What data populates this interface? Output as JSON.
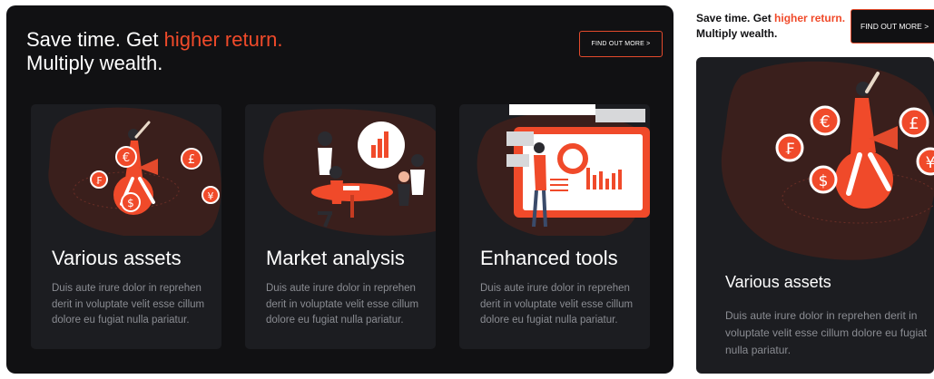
{
  "hero": {
    "title_part1": "Save time. Get ",
    "title_accent": "higher return.",
    "title_line2": "Multiply wealth.",
    "cta_label": "FIND OUT MORE >"
  },
  "cards": [
    {
      "title": "Various assets",
      "body": "Duis aute irure dolor in reprehen derit in voluptate velit esse cillum dolore eu fugiat nulla pariatur.",
      "illustration": "currency-person-illustration"
    },
    {
      "title": "Market analysis",
      "body": "Duis aute irure dolor in reprehen derit in voluptate velit esse cillum dolore eu fugiat nulla pariatur.",
      "illustration": "meeting-illustration"
    },
    {
      "title": "Enhanced tools",
      "body": "Duis aute irure dolor in reprehen derit in voluptate velit esse cillum dolore eu fugiat nulla pariatur.",
      "illustration": "dashboard-illustration"
    }
  ],
  "side_preview": {
    "title_part1": "Save time. Get ",
    "title_accent": "higher return.",
    "title_line2": "Multiply wealth.",
    "cta_label": "FIND OUT MORE >",
    "card_title": "Various assets",
    "card_body": "Duis aute irure dolor in reprehen derit in voluptate velit esse cillum dolore eu fugiat nulla pariatur."
  },
  "currency_symbols": [
    "€",
    "£",
    "₣",
    "$",
    "¥"
  ],
  "colors": {
    "accent": "#f04a2a",
    "panel_bg": "#111113",
    "card_bg": "#1c1d21",
    "blob": "#3a1f1c",
    "body_text": "#8a8c92"
  }
}
